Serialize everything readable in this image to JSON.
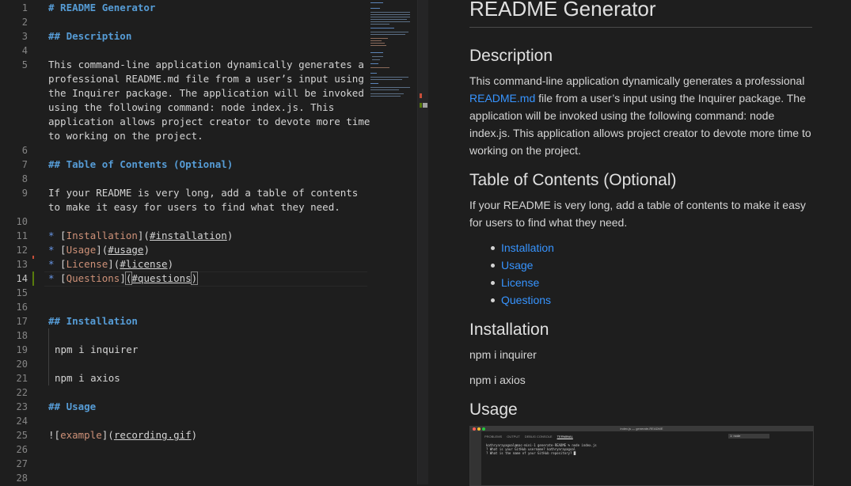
{
  "editor": {
    "line_numbers": [
      "1",
      "2",
      "3",
      "4",
      "5",
      "",
      "",
      "",
      "",
      "",
      "6",
      "7",
      "8",
      "9",
      "",
      "10",
      "11",
      "12",
      "13",
      "14",
      "15",
      "16",
      "17",
      "18",
      "19",
      "20",
      "21",
      "22",
      "23",
      "24",
      "25",
      "26",
      "27",
      "28"
    ],
    "lines": {
      "l1": "# README Generator",
      "l3": "## Description",
      "l5a": "This command-line application dynamically generates a",
      "l5b": "professional README.md file from a user’s input using",
      "l5c": "the Inquirer package. The application will be invoked",
      "l5d": "using the following command: node index.js. This",
      "l5e": "application allows project creator to devote more time",
      "l5f": "to working on the project.",
      "l7": "## Table of Contents (Optional)",
      "l9a": "If your README is very long, add a table of contents",
      "l9b": "to make it easy for users to find what they need.",
      "toc": [
        {
          "bullet": "*",
          "text": "Installation",
          "href": "#installation"
        },
        {
          "bullet": "*",
          "text": "Usage",
          "href": "#usage"
        },
        {
          "bullet": "*",
          "text": "License",
          "href": "#license"
        },
        {
          "bullet": "*",
          "text": "Questions",
          "href": "#questions"
        }
      ],
      "l17": "## Installation",
      "l19": "npm i inquirer",
      "l21": "npm i axios",
      "l23": "## Usage",
      "l25_prefix": "![",
      "l25_alt": "example",
      "l25_mid": "](",
      "l25_src": "recording.gif",
      "l25_end": ")"
    }
  },
  "preview": {
    "title": "README Generator",
    "description_heading": "Description",
    "description_parts": {
      "before": "This command-line application dynamically generates a professional ",
      "link": "README.md",
      "after": " file from a user’s input using the Inquirer package. The application will be invoked using the following command: node index.js. This application allows project creator to devote more time to working on the project."
    },
    "toc_heading": "Table of Contents (Optional)",
    "toc_intro": "If your README is very long, add a table of contents to make it easy for users to find what they need.",
    "toc_items": [
      "Installation",
      "Usage",
      "License",
      "Questions"
    ],
    "installation_heading": "Installation",
    "install_1": "npm i inquirer",
    "install_2": "npm i axios",
    "usage_heading": "Usage",
    "gif": {
      "window_title": "index.js — generate-README",
      "tabs": [
        "PROBLEMS",
        "OUTPUT",
        "DEBUG CONSOLE",
        "TERMINAL"
      ],
      "shell_select": "1: node",
      "lines": [
        "kathrynrayagoal@mac-mini-1 generate-README % node index.js",
        "? What is your GitHub username? kathrynrayagoal",
        "? What is the name of your GitHub repository? █"
      ]
    }
  },
  "colors": {
    "background": "#1e1e1e",
    "heading_md": "#569cd6",
    "link_text_md": "#ce9178",
    "link_preview": "#3794ff"
  }
}
